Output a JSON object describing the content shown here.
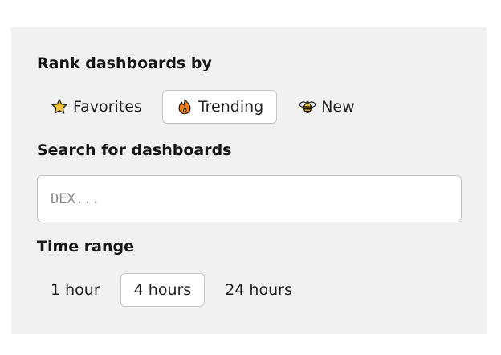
{
  "rank": {
    "label": "Rank dashboards by",
    "options": [
      {
        "label": "Favorites",
        "icon": "star-icon",
        "active": false
      },
      {
        "label": "Trending",
        "icon": "fire-icon",
        "active": true
      },
      {
        "label": "New",
        "icon": "bee-icon",
        "active": false
      }
    ]
  },
  "search": {
    "label": "Search for dashboards",
    "value": "",
    "placeholder": "DEX..."
  },
  "time_range": {
    "label": "Time range",
    "options": [
      {
        "label": "1 hour",
        "active": false
      },
      {
        "label": "4 hours",
        "active": true
      },
      {
        "label": "24 hours",
        "active": false
      }
    ]
  },
  "colors": {
    "panel_bg": "#f1f1f1",
    "active_bg": "#ffffff",
    "border": "#c6c6c6"
  }
}
